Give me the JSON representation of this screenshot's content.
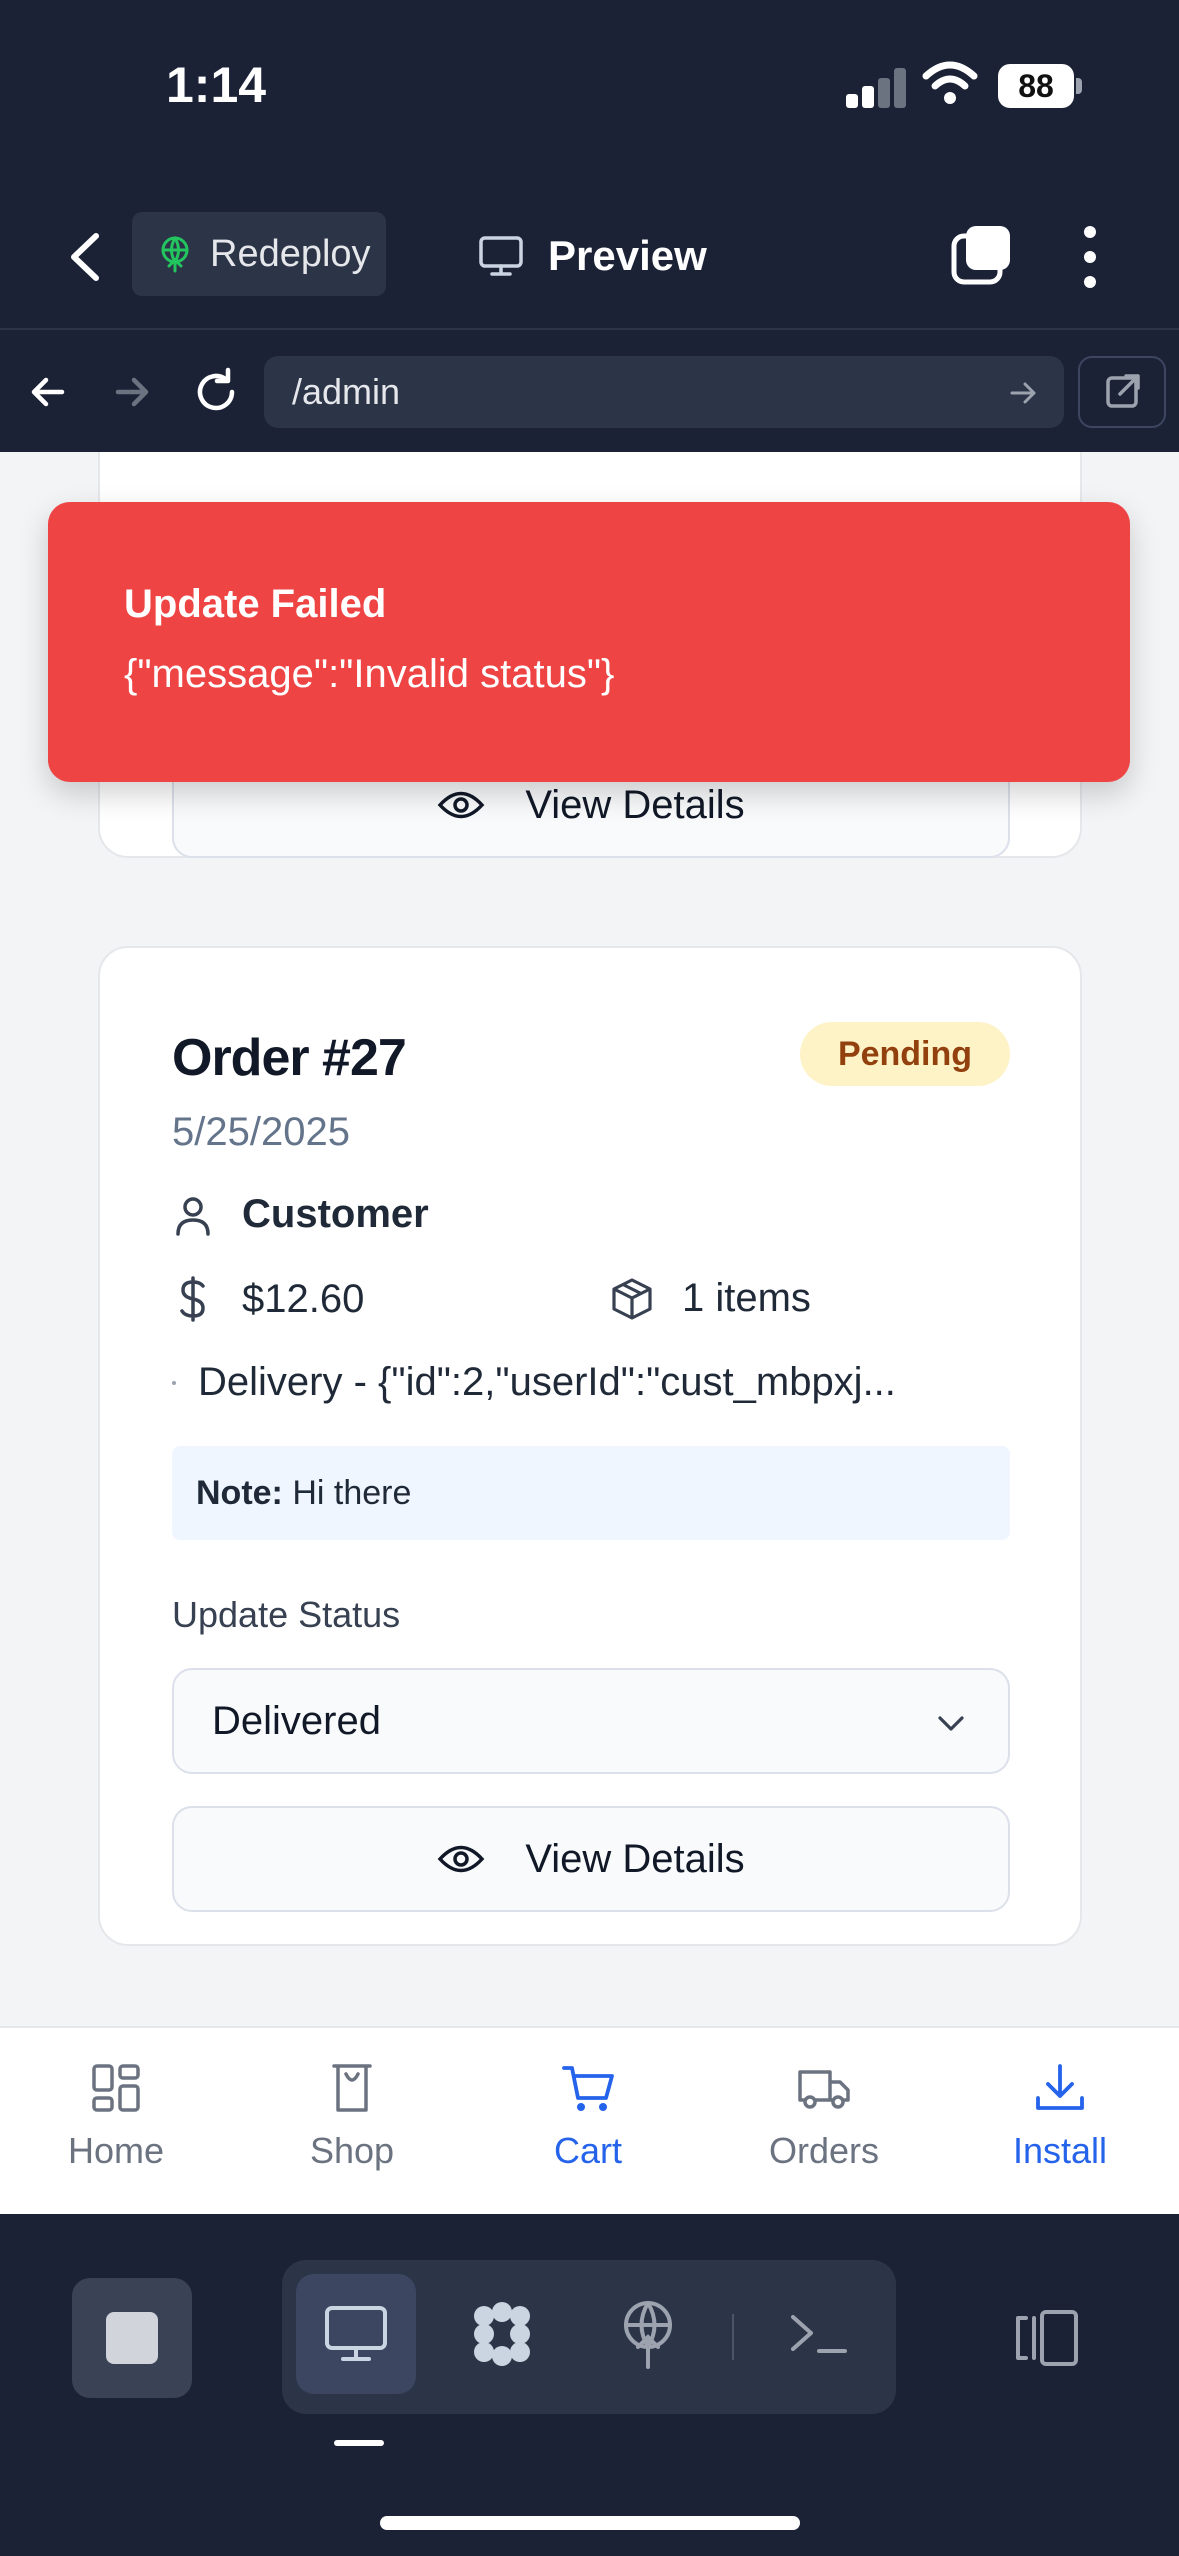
{
  "status_bar": {
    "time": "1:14",
    "battery": "88"
  },
  "header": {
    "redeploy_label": "Redeploy",
    "preview_label": "Preview"
  },
  "browser": {
    "url": "/admin"
  },
  "toast": {
    "title": "Update Failed",
    "message": "{\"message\":\"Invalid status\"}"
  },
  "previous_card": {
    "view_details_label": "View Details"
  },
  "order": {
    "title": "Order #27",
    "status_badge": "Pending",
    "date": "5/25/2025",
    "customer": "Customer",
    "amount": "$12.60",
    "items": "1 items",
    "delivery": "Delivery - {\"id\":2,\"userId\":\"cust_mbpxj...",
    "note_label": "Note:",
    "note_text": "Hi there",
    "update_status_label": "Update Status",
    "selected_status": "Delivered",
    "view_details_label": "View Details"
  },
  "bottom_nav": [
    {
      "label": "Home",
      "icon": "grid-icon",
      "active": false
    },
    {
      "label": "Shop",
      "icon": "shop-icon",
      "active": false
    },
    {
      "label": "Cart",
      "icon": "cart-icon",
      "active": true
    },
    {
      "label": "Orders",
      "icon": "truck-icon",
      "active": false
    },
    {
      "label": "Install",
      "icon": "download-icon",
      "active": true
    }
  ],
  "colors": {
    "toast_bg": "#ef4444",
    "accent": "#2563eb",
    "badge_bg": "#fef3c7",
    "badge_text": "#92400e",
    "chrome_bg": "#1b2236"
  }
}
